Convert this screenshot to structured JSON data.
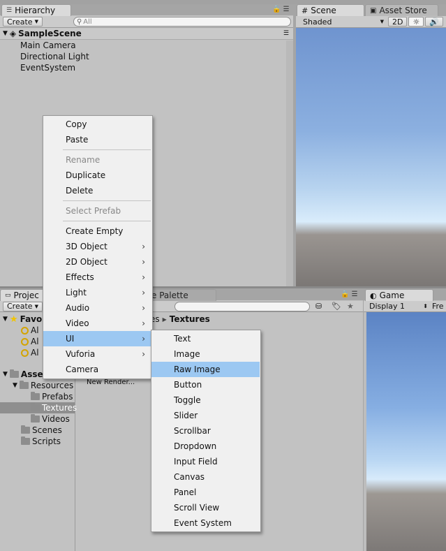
{
  "hierarchy": {
    "tab_label": "Hierarchy",
    "create_label": "Create",
    "search_placeholder": "All",
    "scene_name": "SampleScene",
    "items": [
      "Main Camera",
      "Directional Light",
      "EventSystem"
    ]
  },
  "scene": {
    "tab_label": "Scene",
    "asset_store_tab": "Asset Store",
    "shading_mode": "Shaded",
    "mode_2d": "2D"
  },
  "project": {
    "tab_label": "Projec",
    "palette_tab": "e Palette",
    "create_label": "Create",
    "favorites_label": "Favo",
    "favorites_items": [
      "Al",
      "Al",
      "Al"
    ],
    "assets_label": "Asse",
    "folders": [
      "Resources",
      "Prefabs",
      "Textures",
      "Videos",
      "Scenes",
      "Scripts"
    ],
    "breadcrumb_prefix": "es",
    "breadcrumb_current": "Textures",
    "asset_item": "New Render..."
  },
  "game": {
    "tab_label": "Game",
    "display_select": "Display 1",
    "free_aspect": "Fre"
  },
  "context_menu": {
    "items": [
      "Copy",
      "Paste",
      "Rename",
      "Duplicate",
      "Delete",
      "Select Prefab",
      "Create Empty",
      "3D Object",
      "2D Object",
      "Effects",
      "Light",
      "Audio",
      "Video",
      "UI",
      "Vuforia",
      "Camera"
    ],
    "disabled": [
      "Rename",
      "Select Prefab"
    ],
    "submenu_arrow": "›",
    "highlighted": "UI"
  },
  "ui_submenu": {
    "items": [
      "Text",
      "Image",
      "Raw Image",
      "Button",
      "Toggle",
      "Slider",
      "Scrollbar",
      "Dropdown",
      "Input Field",
      "Canvas",
      "Panel",
      "Scroll View",
      "Event System"
    ],
    "highlighted": "Raw Image"
  },
  "colors": {
    "menu_highlight": "#9cc8f2",
    "panel_bg": "#c2c2c2",
    "selected_folder": "#8f8f8f"
  }
}
